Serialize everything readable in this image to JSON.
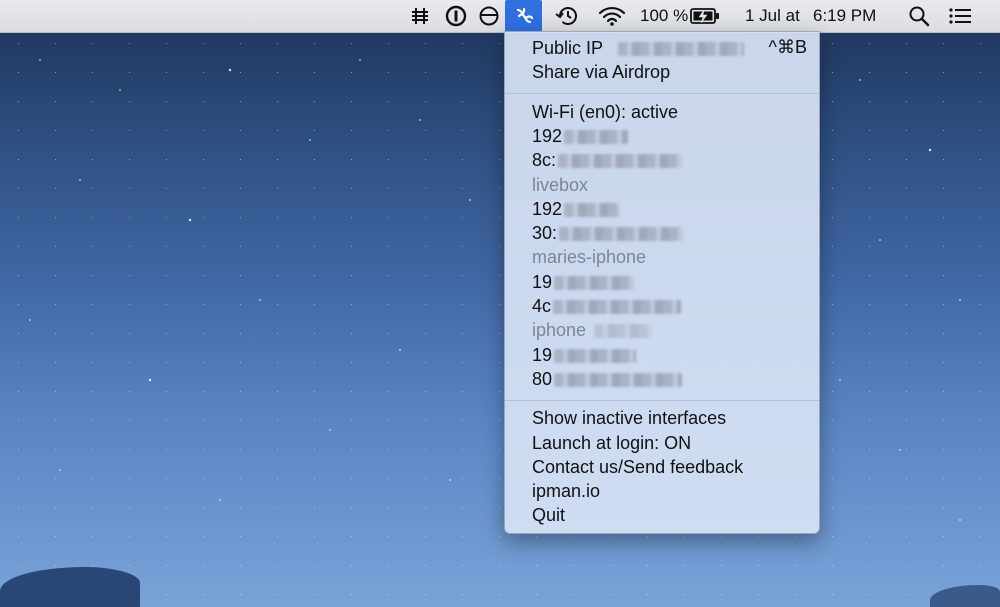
{
  "colors": {
    "menubar_bg": "#e3e4ea",
    "menu_bg": "#d6e2f5",
    "accent": "#2f6fe0",
    "dim_text": "#7d8597"
  },
  "menubar": {
    "battery_percent": "100 %",
    "date": "1 Jul at",
    "time": "6:19 PM",
    "icons": [
      "hashtag-icon",
      "1password-icon",
      "circle-half-icon",
      "ipman-app-icon",
      "time-machine-icon",
      "wifi-icon",
      "battery-charging-icon",
      "spotlight-search-icon",
      "notification-center-icon"
    ]
  },
  "menu": {
    "public_ip_label": "Public IP",
    "public_ip_shortcut": "^⌘B",
    "share_airdrop": "Share via Airdrop",
    "wifi_header": "Wi-Fi (en0): active",
    "entries": [
      {
        "ip_prefix": "192",
        "mac_prefix": "8c:",
        "name": null
      },
      {
        "name": "livebox",
        "ip_prefix": "192",
        "mac_prefix": "30:"
      },
      {
        "name": "maries-iphone",
        "ip_prefix": "19",
        "mac_prefix": "4c"
      },
      {
        "name": "iphone",
        "ip_prefix": "19",
        "mac_prefix": "80"
      }
    ],
    "show_inactive": "Show inactive interfaces",
    "launch_at_login": "Launch at login: ON",
    "contact": "Contact us/Send feedback",
    "website": "ipman.io",
    "quit": "Quit"
  }
}
